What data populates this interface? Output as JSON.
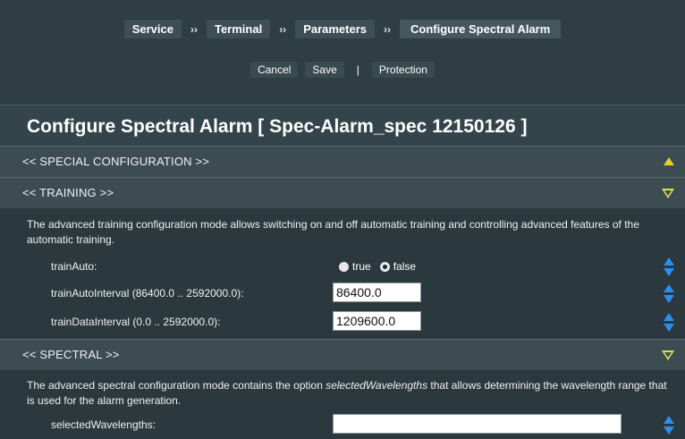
{
  "breadcrumb": {
    "items": [
      "Service",
      "Terminal",
      "Parameters",
      "Configure Spectral Alarm"
    ],
    "separator": "››"
  },
  "actions": {
    "cancel": "Cancel",
    "save": "Save",
    "divider": "|",
    "protection": "Protection"
  },
  "page_title": "Configure Spectral Alarm [ Spec-Alarm_spec 12150126 ]",
  "sections": {
    "special": {
      "label": "<<  SPECIAL CONFIGURATION  >>",
      "toggle_icon": "triangle-up-icon"
    },
    "training": {
      "label": "<<  TRAINING  >>",
      "toggle_icon": "triangle-down-icon",
      "description": "The advanced training configuration mode allows switching on and off automatic training and controlling advanced features of the automatic training.",
      "params": {
        "trainAuto": {
          "label": "trainAuto:",
          "options": [
            "true",
            "false"
          ],
          "selected": "false"
        },
        "trainAutoInterval": {
          "label": "trainAutoInterval (86400.0 .. 2592000.0):",
          "value": "86400.0"
        },
        "trainDataInterval": {
          "label": "trainDataInterval (0.0 .. 2592000.0):",
          "value": "1209600.0"
        }
      }
    },
    "spectral": {
      "label": "<<  SPECTRAL  >>",
      "toggle_icon": "triangle-down-icon",
      "description_before": "The advanced spectral configuration mode contains the option ",
      "description_em": "selectedWavelengths",
      "description_after": " that allows determining the wavelength range that is used for the alarm generation.",
      "params": {
        "selectedWavelengths": {
          "label": "selectedWavelengths:",
          "value": ""
        }
      }
    }
  },
  "colors": {
    "background": "#2d3a40",
    "accent_triangle": "#d9e24c",
    "spinner": "#2a8ff0"
  }
}
